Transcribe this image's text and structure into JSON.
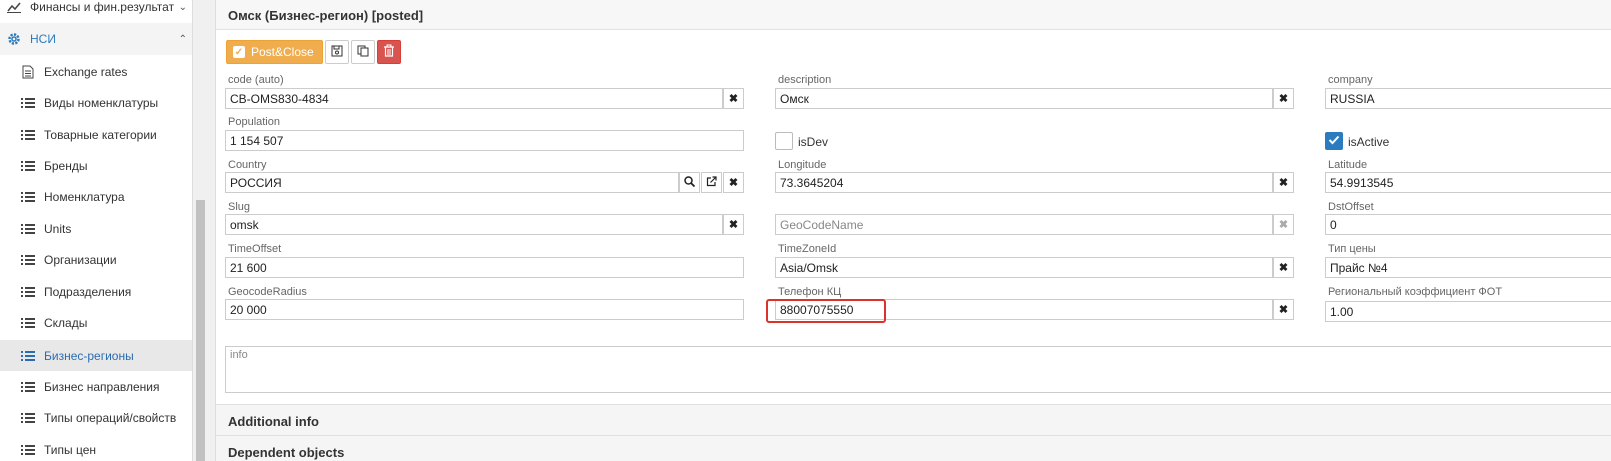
{
  "sidebar": {
    "finance": "Финансы и фин.результат",
    "nsi": "НСИ",
    "items": [
      {
        "label": "Exchange rates"
      },
      {
        "label": "Виды номенклатуры"
      },
      {
        "label": "Товарные категории"
      },
      {
        "label": "Бренды"
      },
      {
        "label": "Номенклатура"
      },
      {
        "label": "Units"
      },
      {
        "label": "Организации"
      },
      {
        "label": "Подразделения"
      },
      {
        "label": "Склады"
      },
      {
        "label": "Бизнес-регионы"
      },
      {
        "label": "Бизнес направления"
      },
      {
        "label": "Типы операций/свойств"
      },
      {
        "label": "Типы цен"
      }
    ]
  },
  "header": {
    "title": "Омск (Бизнес-регион) [posted]"
  },
  "toolbar": {
    "post_close": "Post&Close"
  },
  "form": {
    "code_label": "code (auto)",
    "code_value": "CB-OMS830-4834",
    "description_label": "description",
    "description_value": "Омск",
    "company_label": "company",
    "company_value": "RUSSIA",
    "population_label": "Population",
    "population_value": "1 154 507",
    "isdev_label": "isDev",
    "isactive_label": "isActive",
    "country_label": "Country",
    "country_value": "РОССИЯ",
    "longitude_label": "Longitude",
    "longitude_value": "73.3645204",
    "latitude_label": "Latitude",
    "latitude_value": "54.9913545",
    "slug_label": "Slug",
    "slug_value": "omsk",
    "geocodename_placeholder": "GeoCodeName",
    "dstoffset_label": "DstOffset",
    "dstoffset_value": "0",
    "timeoffset_label": "TimeOffset",
    "timeoffset_value": "21 600",
    "timezone_label": "TimeZoneId",
    "timezone_value": "Asia/Omsk",
    "pricetype_label": "Тип цены",
    "pricetype_value": "Прайс №4",
    "geocoderadius_label": "GeocodeRadius",
    "geocoderadius_value": "20 000",
    "phone_label": "Телефон КЦ",
    "phone_value": "88007075550",
    "coef_label": "Региональный коэффициент ФОТ",
    "coef_value": "1.00",
    "info_placeholder": "info"
  },
  "sections": {
    "additional": "Additional info",
    "dependent": "Dependent objects"
  }
}
